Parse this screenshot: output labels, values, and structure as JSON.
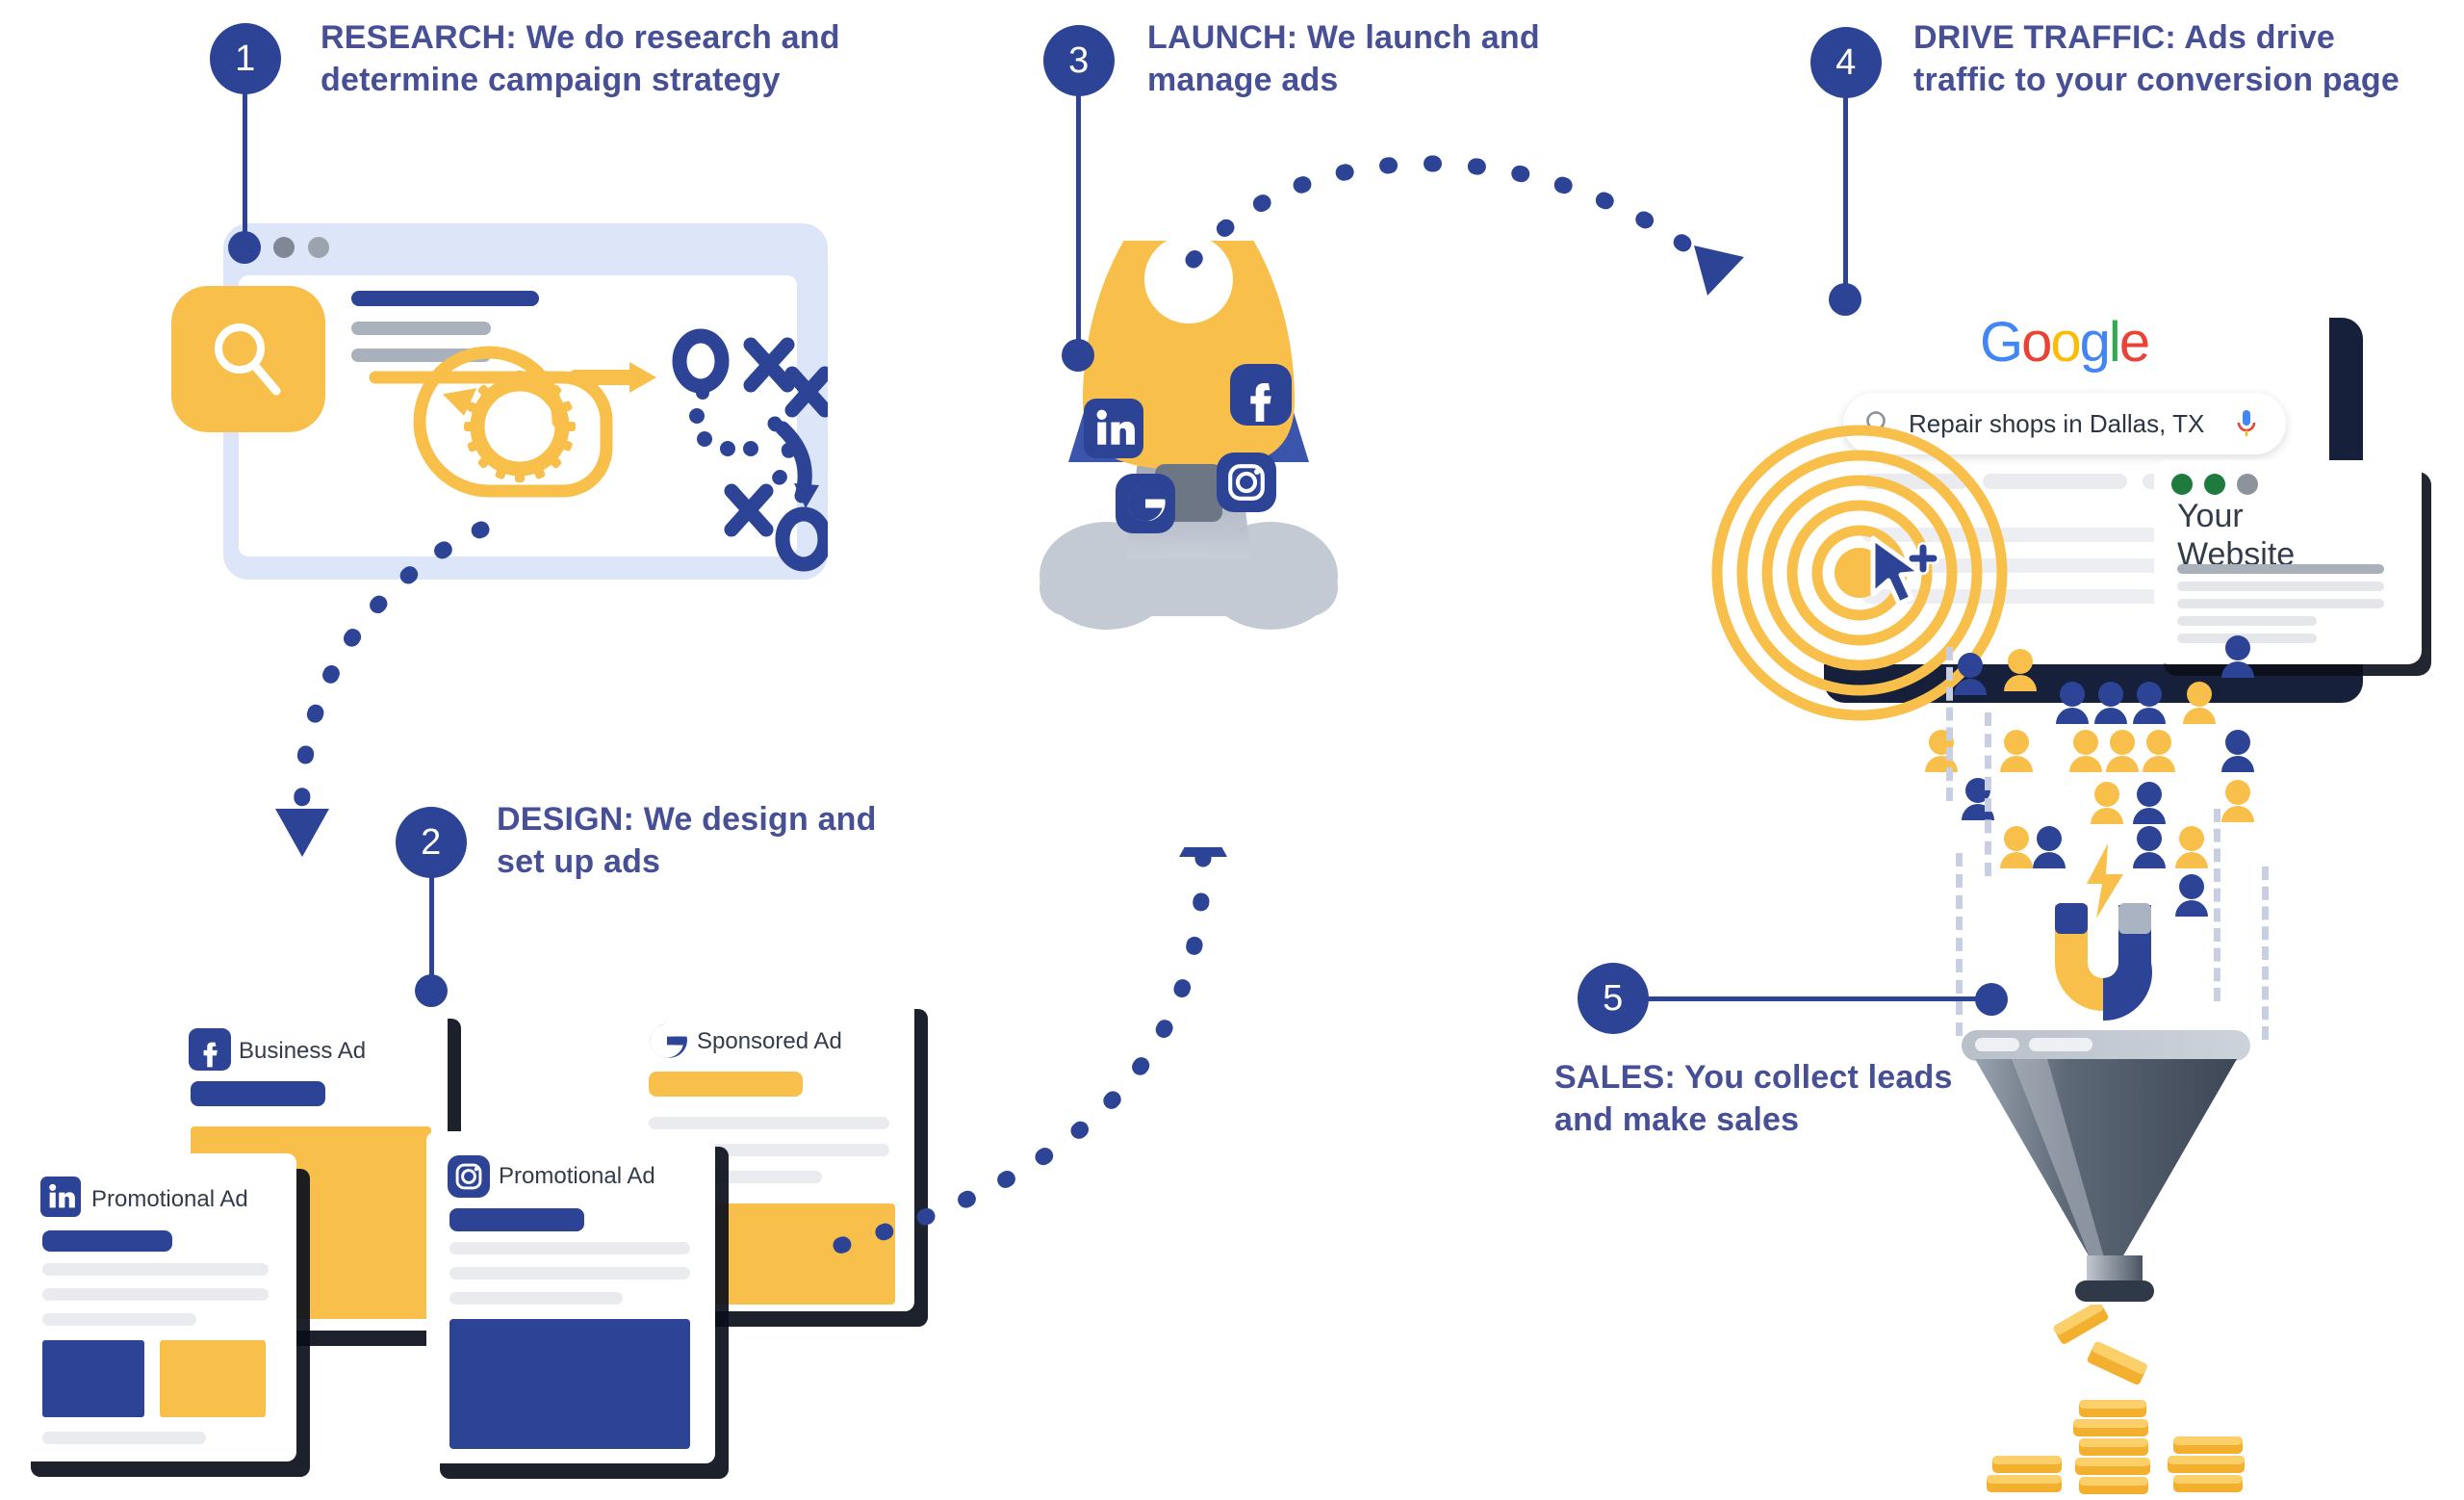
{
  "steps": [
    {
      "number": "1",
      "title": "RESEARCH:",
      "body": " We do research and determine campaign strategy"
    },
    {
      "number": "2",
      "title": "DESIGN:",
      "body": " We design and set up ads"
    },
    {
      "number": "3",
      "title": "LAUNCH:",
      "body": " We launch and manage ads"
    },
    {
      "number": "4",
      "title": "DRIVE TRAFFIC:",
      "body": " Ads drive traffic to your conversion page"
    },
    {
      "number": "5",
      "title": "SALES:",
      "body": " You collect leads and make sales"
    }
  ],
  "research_window": {
    "icon": "magnifier-icon",
    "dot_colors": [
      "#2d4496",
      "#7f8894",
      "#9aa3ae"
    ]
  },
  "ad_cards": [
    {
      "network": "facebook",
      "icon": "facebook-icon",
      "label": "Business Ad"
    },
    {
      "network": "linkedin",
      "icon": "linkedin-icon",
      "label": "Promotional Ad"
    },
    {
      "network": "instagram",
      "icon": "instagram-icon",
      "label": "Promotional Ad"
    },
    {
      "network": "google",
      "icon": "google-g-icon",
      "label": "Sponsored Ad"
    }
  ],
  "rocket": {
    "social_icons": [
      "linkedin-icon",
      "facebook-icon",
      "google-g-icon",
      "instagram-icon"
    ]
  },
  "google_panel": {
    "logo": [
      "G",
      "o",
      "o",
      "g",
      "l",
      "e"
    ],
    "search_query": "Repair shops in Dallas, TX",
    "search_icon": "search-icon",
    "mic_icon": "microphone-icon",
    "cursor_icon": "cursor-plus-icon",
    "target_icon": "bullseye-icon"
  },
  "website_card": {
    "title_line1": "Your",
    "title_line2": "Website",
    "dot_colors": [
      "#1e7a3d",
      "#1e7a3d",
      "#8c939c"
    ]
  },
  "sales": {
    "magnet_icon": "magnet-icon",
    "bolt_icon": "lightning-bolt-icon",
    "funnel_icon": "funnel-icon",
    "coins_icon": "coin-stack-icon"
  },
  "colors": {
    "brand_blue": "#2d4496",
    "brand_yellow": "#f8c04a",
    "caption_text": "#474f95",
    "panel_light": "#dde5f9"
  }
}
